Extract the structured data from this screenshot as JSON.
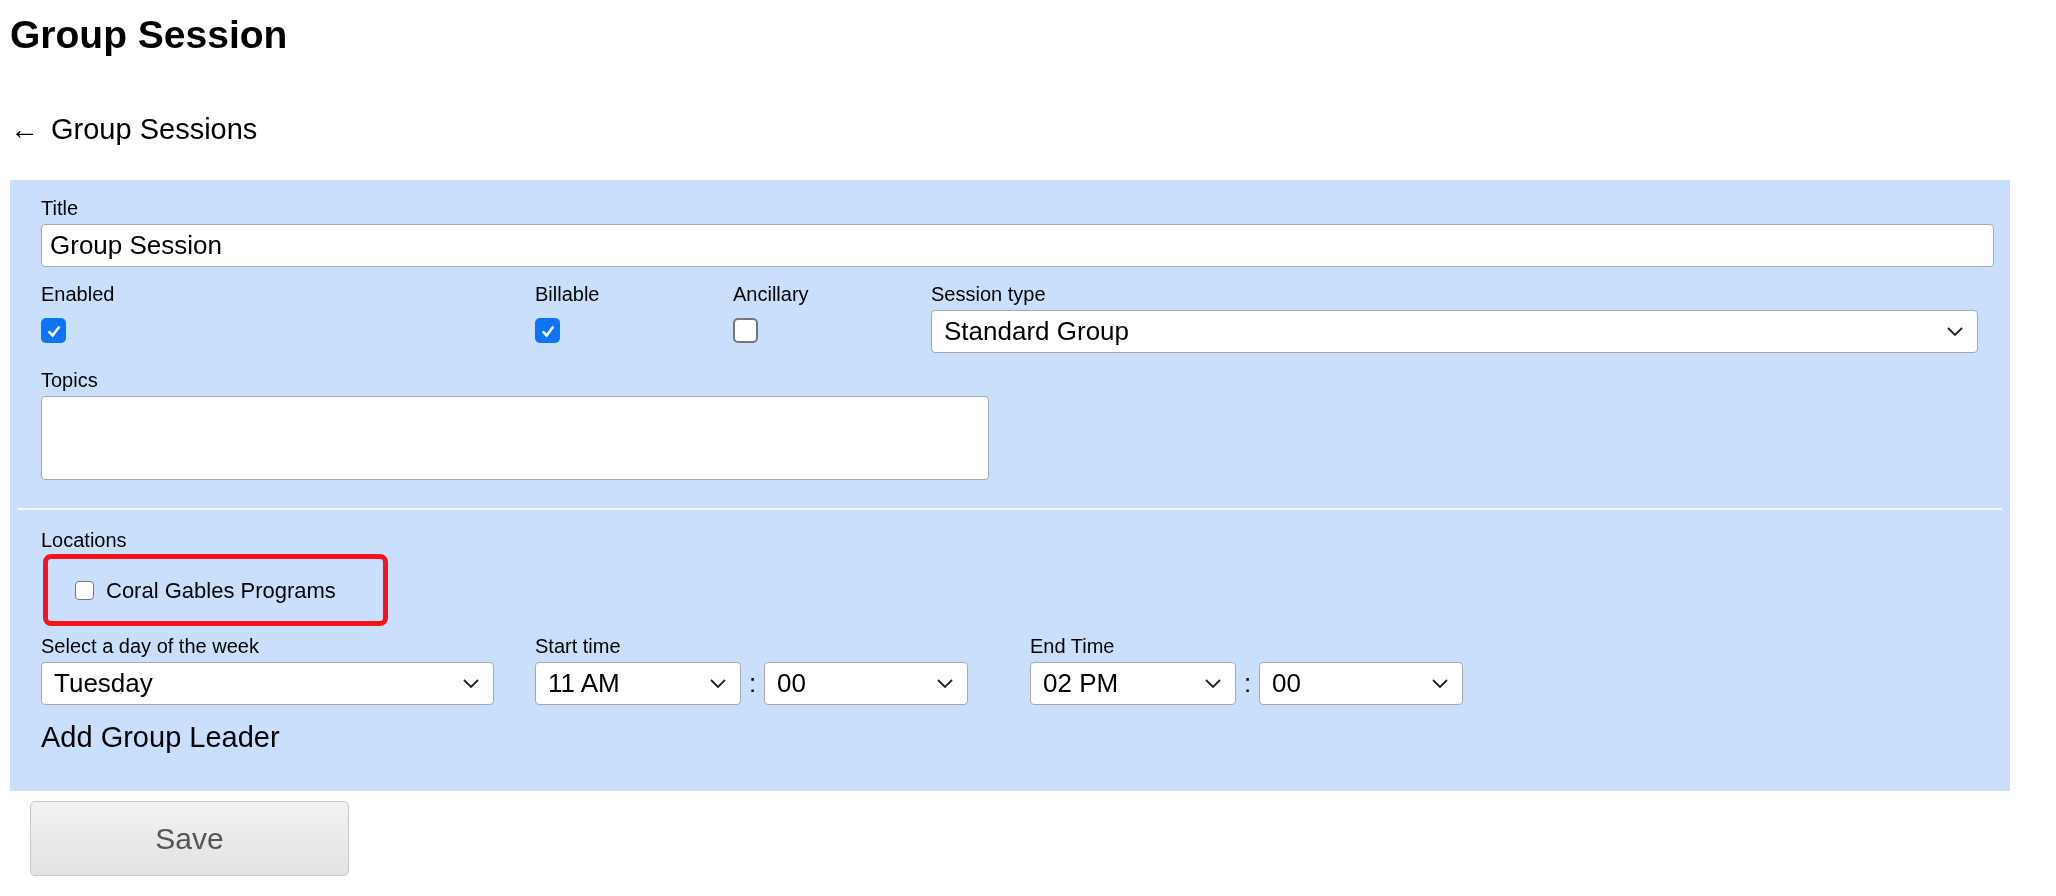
{
  "page": {
    "title": "Group Session"
  },
  "back_link": {
    "arrow": "←",
    "label": "Group Sessions"
  },
  "form": {
    "title_field": {
      "label": "Title",
      "value": "Group Session"
    },
    "flags": [
      {
        "label": "Enabled",
        "checked": true
      },
      {
        "label": "Billable",
        "checked": true
      },
      {
        "label": "Ancillary",
        "checked": false
      }
    ],
    "session_type": {
      "label": "Session type",
      "value": "Standard Group"
    },
    "topics": {
      "label": "Topics"
    },
    "locations": {
      "label": "Locations",
      "highlighted": true,
      "options": [
        {
          "label": "Coral Gables Programs",
          "checked": false
        }
      ]
    },
    "day": {
      "label": "Select a day of the week",
      "value": "Tuesday"
    },
    "start_time": {
      "label": "Start time",
      "hour": "11 AM",
      "separator": ":",
      "minute": "00"
    },
    "end_time": {
      "label": "End Time",
      "hour": "02 PM",
      "separator": ":",
      "minute": "00"
    },
    "add_group_leader": "Add Group Leader"
  },
  "save_button": {
    "label": "Save"
  }
}
